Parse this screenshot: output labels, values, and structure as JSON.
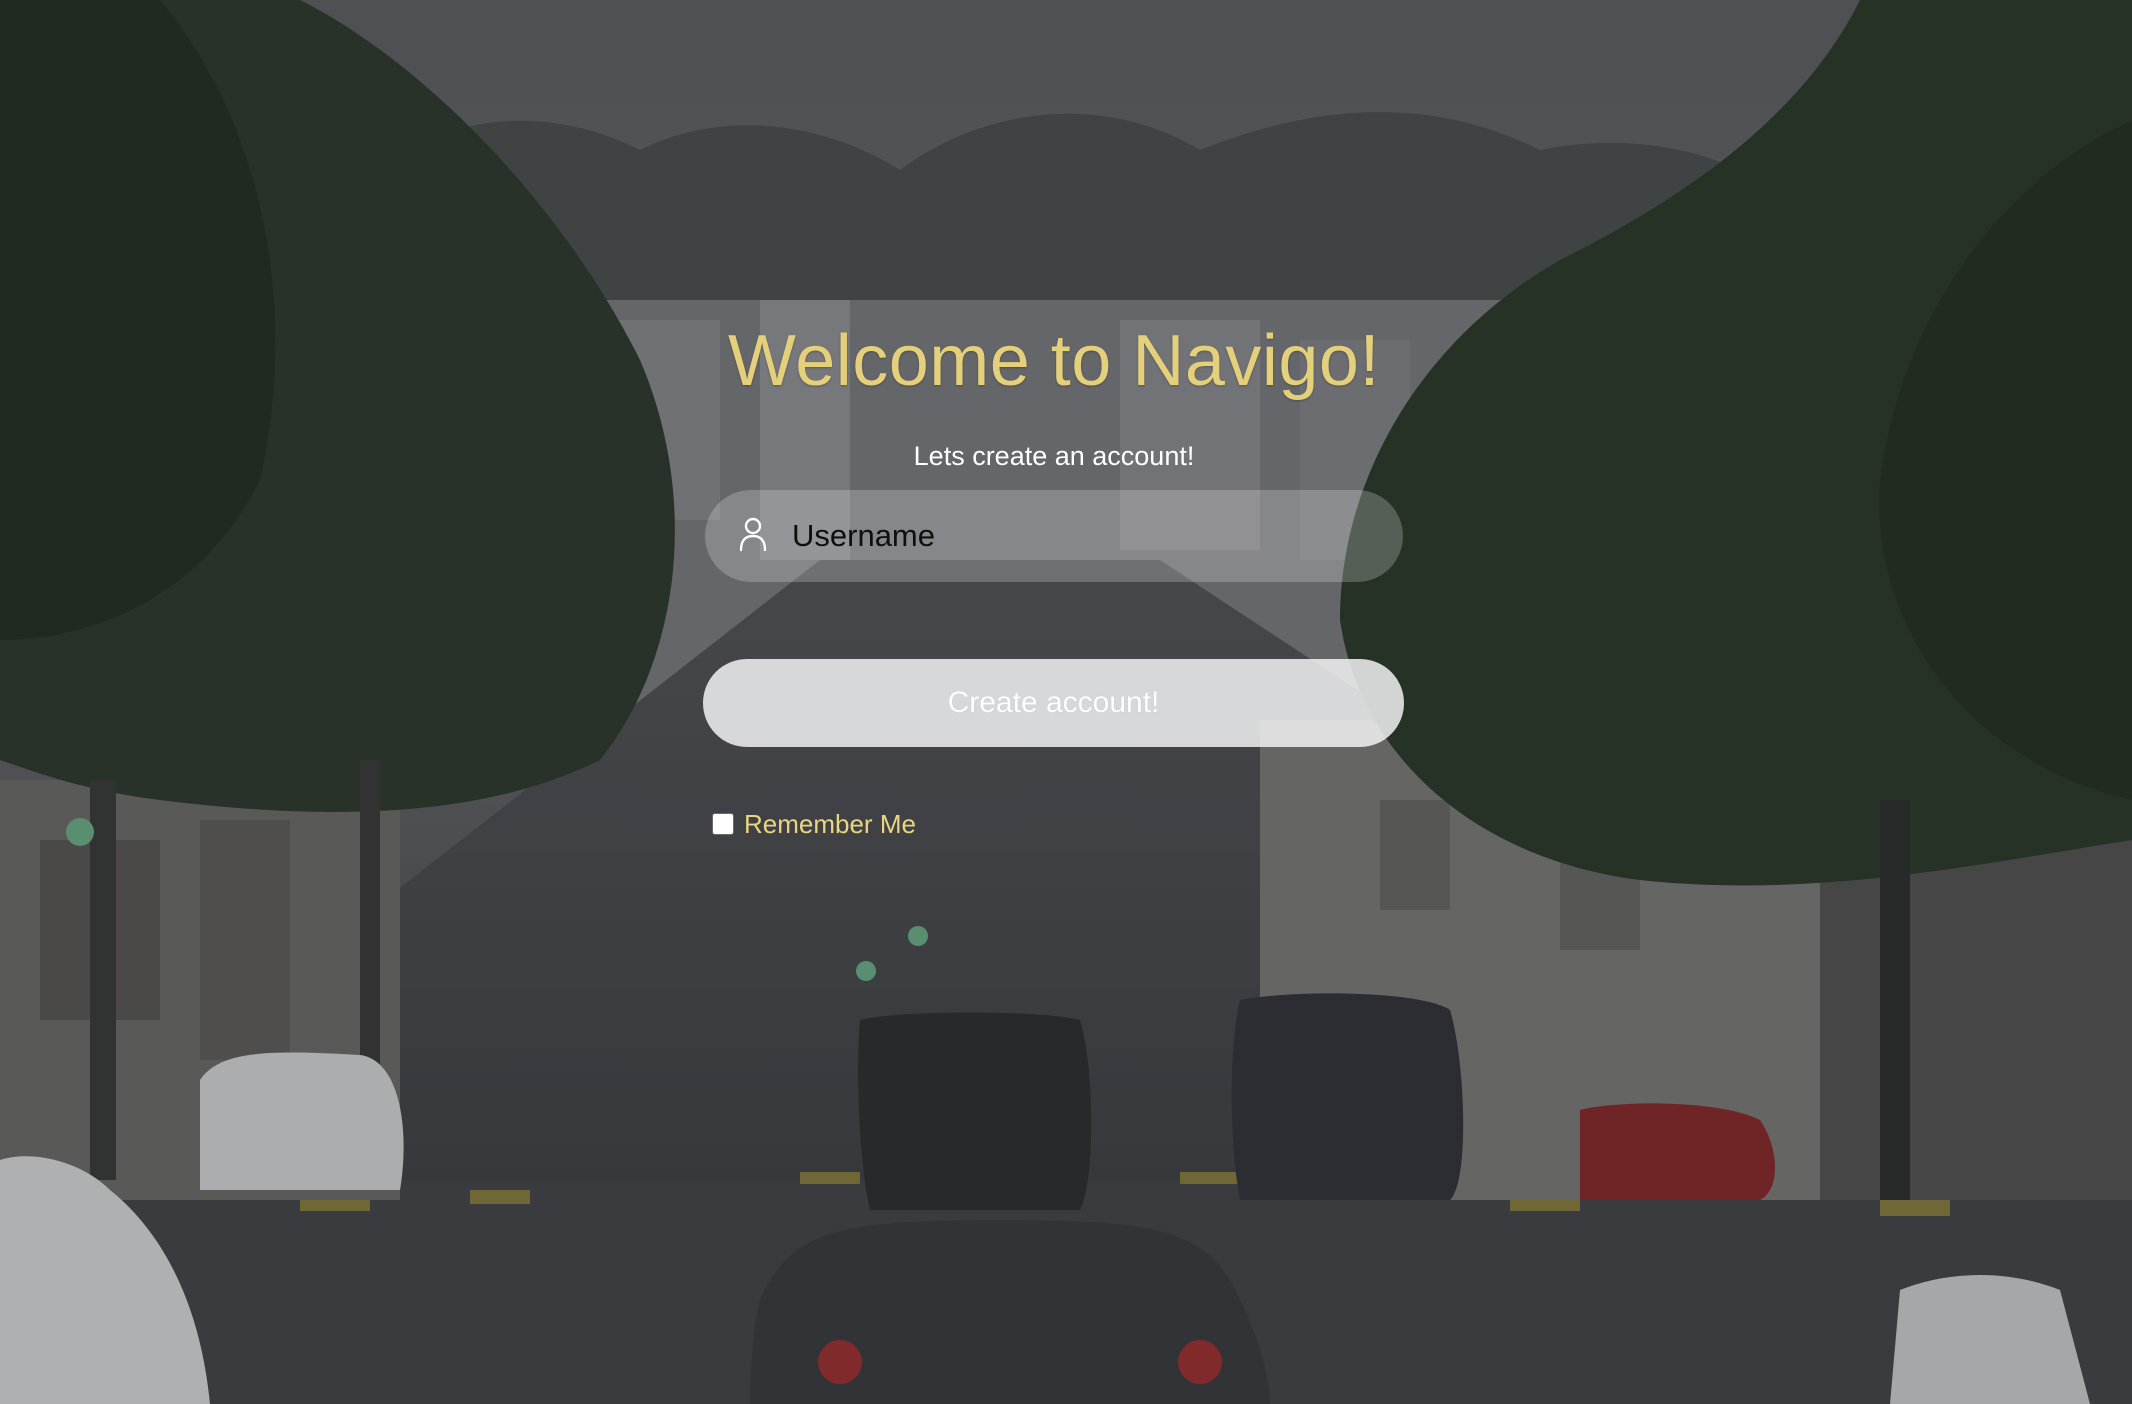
{
  "page": {
    "title": "Welcome to Navigo!",
    "subtitle": "Lets create an account!"
  },
  "form": {
    "username_placeholder": "Username",
    "username_value": "",
    "submit_label": "Create account!",
    "remember_label": "Remember Me",
    "remember_checked": false
  },
  "icons": {
    "username": "user-icon"
  },
  "colors": {
    "title": "#e4cf7a",
    "remember_label": "#e9d57f",
    "button_bg": "#f2f2f4",
    "text_on_button": "#ffffff"
  }
}
